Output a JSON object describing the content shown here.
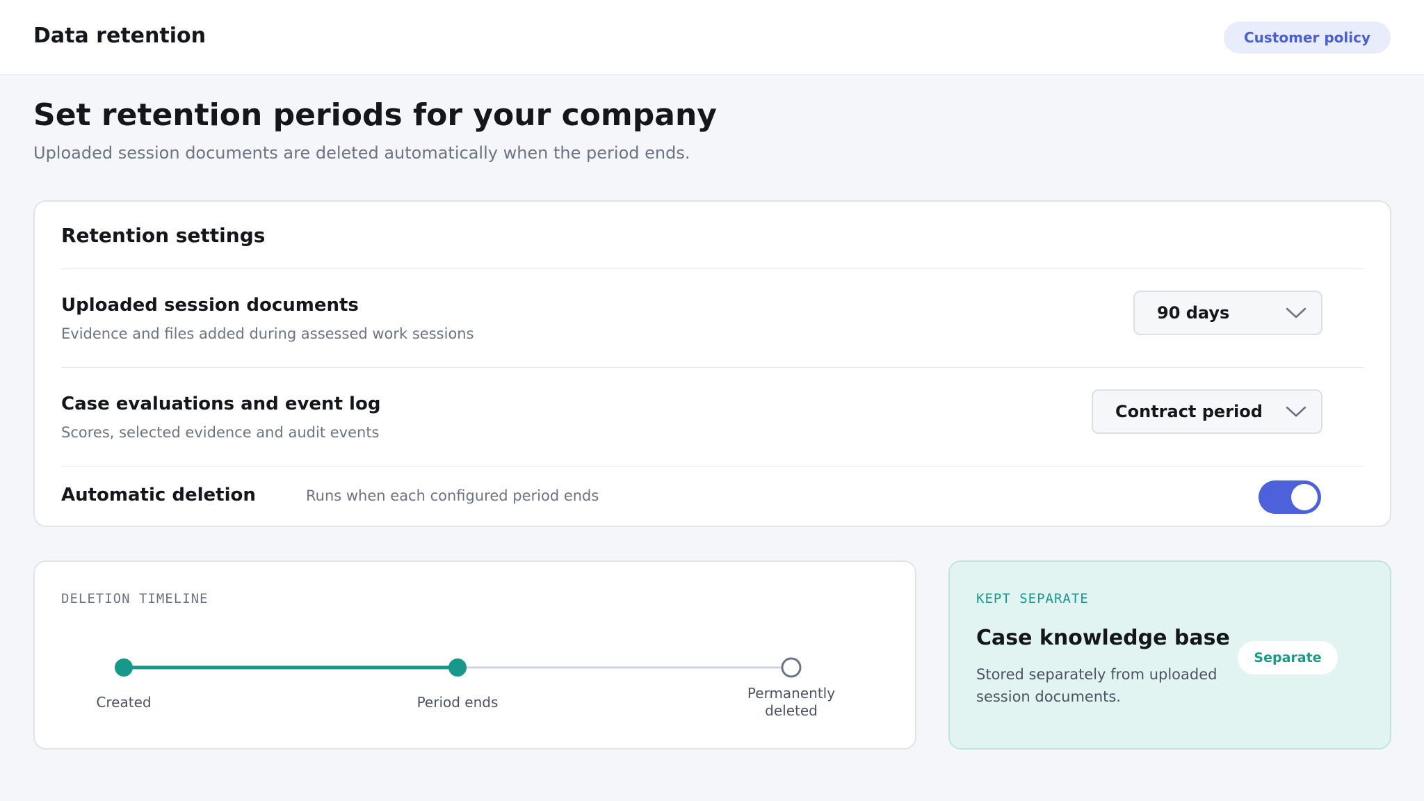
{
  "header": {
    "title": "Data retention",
    "policy_button": "Customer policy"
  },
  "page": {
    "heading": "Set retention periods for your company",
    "subtitle": "Uploaded session documents are deleted automatically when the period ends."
  },
  "retention_settings": {
    "title": "Retention settings",
    "rows": [
      {
        "title": "Uploaded session documents",
        "description": "Evidence and files added during assessed work sessions",
        "selected_value": "90 days"
      },
      {
        "title": "Case evaluations and event log",
        "description": "Scores, selected evidence and audit events",
        "selected_value": "Contract period"
      }
    ],
    "automatic_deletion": {
      "title": "Automatic deletion",
      "description": "Runs when each configured period ends",
      "enabled": true
    }
  },
  "timeline": {
    "eyebrow": "DELETION TIMELINE",
    "steps": [
      {
        "label": "Created",
        "status": "complete"
      },
      {
        "label": "Period ends",
        "status": "complete"
      },
      {
        "label": "Permanently deleted",
        "status": "pending"
      }
    ]
  },
  "knowledge_base": {
    "eyebrow": "KEPT SEPARATE",
    "title": "Case knowledge base",
    "description": "Stored separately from uploaded session documents.",
    "badge": "Separate"
  },
  "colors": {
    "accent_blue": "#4d62da",
    "accent_teal": "#17998a",
    "pill_bg": "#e8ecfb",
    "kb_bg": "#e2f4f1",
    "muted_text": "#6b7385"
  }
}
